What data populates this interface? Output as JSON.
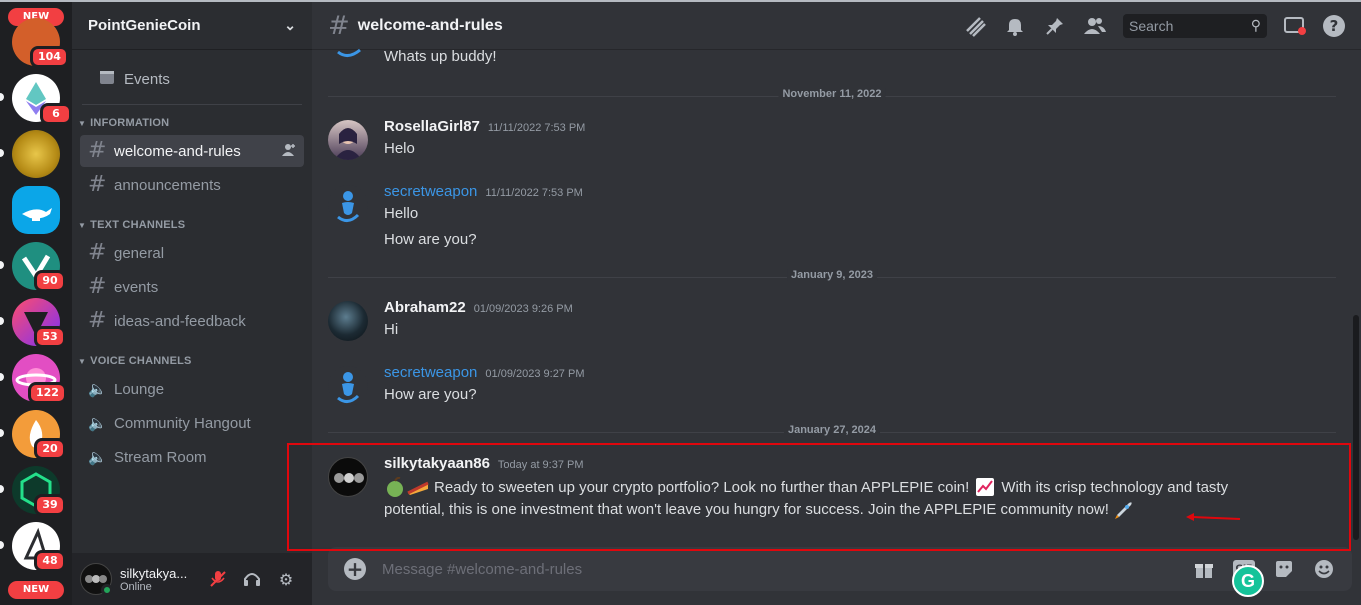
{
  "server": {
    "name": "PointGenieCoin",
    "rail": [
      {
        "new_label": "NEW",
        "badge": "104",
        "color": "#d35f2a"
      },
      {
        "badge": "6",
        "color": "#ffffff"
      },
      {
        "badge": "",
        "color": "#c9a227"
      },
      {
        "badge": "",
        "color": "#0ba6e8"
      },
      {
        "badge": "90",
        "color": "#1f8f80"
      },
      {
        "badge": "53",
        "color": "#c0356a"
      },
      {
        "badge": "122",
        "color": "#e24ec3"
      },
      {
        "badge": "20",
        "color": "#f39c3a"
      },
      {
        "badge": "39",
        "color": "#0d3a2b"
      },
      {
        "badge": "48",
        "color": "#ffffff"
      },
      {
        "new_label": "NEW"
      }
    ]
  },
  "sidebar": {
    "events_label": "Events",
    "categories": [
      {
        "label": "INFORMATION",
        "channels": [
          {
            "type": "text",
            "label": "welcome-and-rules",
            "active": true
          },
          {
            "type": "text",
            "label": "announcements"
          }
        ]
      },
      {
        "label": "TEXT CHANNELS",
        "channels": [
          {
            "type": "text",
            "label": "general"
          },
          {
            "type": "text",
            "label": "events"
          },
          {
            "type": "text",
            "label": "ideas-and-feedback"
          }
        ]
      },
      {
        "label": "VOICE CHANNELS",
        "channels": [
          {
            "type": "voice",
            "label": "Lounge"
          },
          {
            "type": "voice",
            "label": "Community Hangout"
          },
          {
            "type": "voice",
            "label": "Stream Room"
          }
        ]
      }
    ]
  },
  "user_panel": {
    "username": "silkytakya...",
    "status": "Online"
  },
  "header": {
    "channel": "welcome-and-rules",
    "search_placeholder": "Search",
    "help_glyph": "?"
  },
  "messages": {
    "partial_text": "Whats up buddy!",
    "dividers": [
      "November 11, 2022",
      "January 9, 2023",
      "January 27, 2024"
    ],
    "items": [
      {
        "author": "RosellaGirl87",
        "timestamp": "11/11/2022 7:53 PM",
        "lines": [
          "Helo"
        ]
      },
      {
        "author": "secretweapon",
        "timestamp": "11/11/2022 7:53 PM",
        "lines": [
          "Hello",
          "How are you?"
        ]
      },
      {
        "author": "Abraham22",
        "timestamp": "01/09/2023 9:26 PM",
        "lines": [
          "Hi"
        ]
      },
      {
        "author": "secretweapon",
        "timestamp": "01/09/2023 9:27 PM",
        "lines": [
          "How are you?"
        ]
      },
      {
        "author": "silkytakyaan86",
        "timestamp": "Today at 9:37 PM",
        "lines": [
          "Ready to sweeten up your crypto portfolio? Look no further than APPLEPIE coin!",
          "With its crisp technology and tasty",
          "potential, this is one investment that won't leave you hungry for success. Join the APPLEPIE community now!"
        ]
      }
    ]
  },
  "composer": {
    "placeholder": "Message #welcome-and-rules",
    "gif_label": "GIF"
  },
  "overlay": {
    "highlight_color": "#e0070d",
    "grammarly_letter": "G"
  }
}
